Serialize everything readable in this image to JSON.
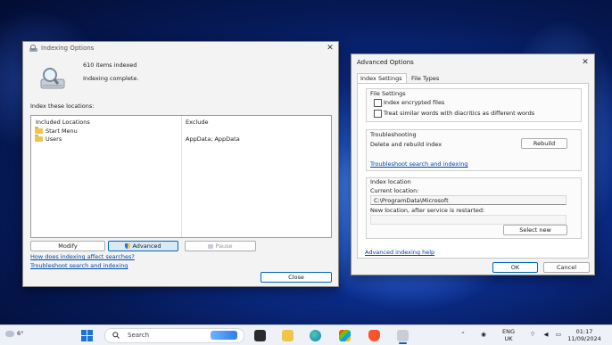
{
  "indexing": {
    "title": "Indexing Options",
    "items_indexed": "610 items indexed",
    "status": "Indexing complete.",
    "index_these": "Index these locations:",
    "col_included": "Included Locations",
    "col_exclude": "Exclude",
    "rows": [
      {
        "location": "Start Menu",
        "exclude": ""
      },
      {
        "location": "Users",
        "exclude": "AppData; AppData"
      }
    ],
    "modify": "Modify",
    "advanced": "Advanced",
    "pause": "Pause",
    "link_how": "How does indexing affect searches?",
    "link_troubleshoot": "Troubleshoot search and indexing",
    "close": "Close"
  },
  "advanced": {
    "title": "Advanced Options",
    "tab_settings": "Index Settings",
    "tab_types": "File Types",
    "file_settings": "File Settings",
    "cb_encrypted": "Index encrypted files",
    "cb_diacritics": "Treat similar words with diacritics as different words",
    "troubleshooting": "Troubleshooting",
    "delete_rebuild": "Delete and rebuild index",
    "rebuild": "Rebuild",
    "link_troubleshoot": "Troubleshoot search and indexing",
    "index_location": "Index location",
    "current_location_label": "Current location:",
    "current_location": "C:\\ProgramData\\Microsoft",
    "new_location_label": "New location, after service is restarted:",
    "new_location": "",
    "select_new": "Select new",
    "help_link": "Advanced indexing help",
    "ok": "OK",
    "cancel": "Cancel"
  },
  "taskbar": {
    "weather_temp": "6°",
    "search_placeholder": "Search",
    "lang_top": "ENG",
    "lang_bottom": "UK",
    "time": "01:17",
    "date": "11/09/2024"
  }
}
